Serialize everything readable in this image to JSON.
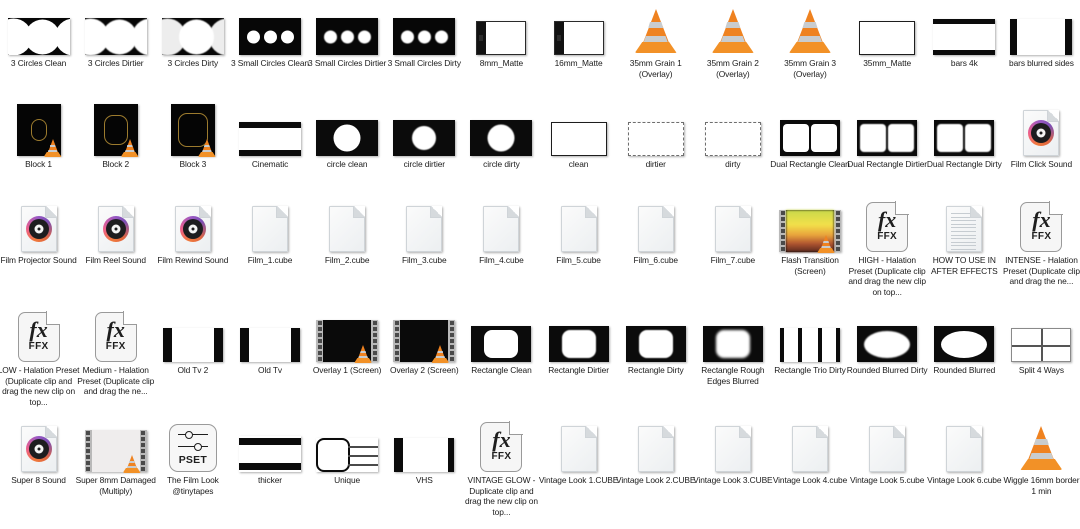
{
  "window": {
    "view": "Large icons grid",
    "background": "#ffffff",
    "columns": 14,
    "rows": 5
  },
  "palette": {
    "label_text": "#1b1b1b",
    "matte_black": "#070707",
    "matte_white": "#ffffff",
    "vlc_orange": "#ef8220",
    "vlc_grey": "#c9ccce",
    "doc_grey": "#eceff1",
    "ffx_border": "#9a9a9a"
  },
  "items": [
    {
      "label": "3 Circles Clean",
      "icon": "matte-3-circles-clean",
      "kind": "image-matte"
    },
    {
      "label": "3 Circles Dirtier",
      "icon": "matte-3-circles-dirtier",
      "kind": "image-matte"
    },
    {
      "label": "3 Circles Dirty",
      "icon": "matte-3-circles-dirty",
      "kind": "image-matte"
    },
    {
      "label": "3 Small Circles Clean",
      "icon": "matte-3-small-circles-clean",
      "kind": "image-matte"
    },
    {
      "label": "3 Small Circles Dirtier",
      "icon": "matte-3-small-circles-dirtier",
      "kind": "image-matte"
    },
    {
      "label": "3 Small Circles Dirty",
      "icon": "matte-3-small-circles-dirty",
      "kind": "image-matte"
    },
    {
      "label": "8mm_Matte",
      "icon": "matte-8mm",
      "kind": "image-matte"
    },
    {
      "label": "16mm_Matte",
      "icon": "matte-16mm",
      "kind": "image-matte"
    },
    {
      "label": "35mm Grain 1 (Overlay)",
      "icon": "vlc-cone-icon",
      "kind": "video"
    },
    {
      "label": "35mm Grain 2 (Overlay)",
      "icon": "vlc-cone-icon",
      "kind": "video"
    },
    {
      "label": "35mm Grain 3 (Overlay)",
      "icon": "vlc-cone-icon",
      "kind": "video"
    },
    {
      "label": "35mm_Matte",
      "icon": "matte-35mm",
      "kind": "image-matte"
    },
    {
      "label": "bars 4k",
      "icon": "matte-bars-4k",
      "kind": "image-matte"
    },
    {
      "label": "bars blurred sides",
      "icon": "matte-bars-blurred-sides",
      "kind": "image-matte"
    },
    {
      "label": "Block 1",
      "icon": "video-thumb-block-1",
      "kind": "video"
    },
    {
      "label": "Block 2",
      "icon": "video-thumb-block-2",
      "kind": "video"
    },
    {
      "label": "Block 3",
      "icon": "video-thumb-block-3",
      "kind": "video"
    },
    {
      "label": "Cinematic",
      "icon": "matte-cinematic",
      "kind": "image-matte"
    },
    {
      "label": "circle clean",
      "icon": "matte-circle-clean",
      "kind": "image-matte"
    },
    {
      "label": "circle dirtier",
      "icon": "matte-circle-dirtier",
      "kind": "image-matte"
    },
    {
      "label": "circle dirty",
      "icon": "matte-circle-dirty",
      "kind": "image-matte"
    },
    {
      "label": "clean",
      "icon": "matte-clean",
      "kind": "image-matte"
    },
    {
      "label": "dirtier",
      "icon": "matte-dirtier",
      "kind": "image-matte"
    },
    {
      "label": "dirty",
      "icon": "matte-dirty",
      "kind": "image-matte"
    },
    {
      "label": "Dual Rectangle Clean",
      "icon": "matte-dual-rectangle-clean",
      "kind": "image-matte"
    },
    {
      "label": "Dual Rectangle Dirtier",
      "icon": "matte-dual-rectangle-dirtier",
      "kind": "image-matte"
    },
    {
      "label": "Dual Rectangle Dirty",
      "icon": "matte-dual-rectangle-dirty",
      "kind": "image-matte"
    },
    {
      "label": "Film Click Sound",
      "icon": "audio-file-icon",
      "kind": "audio"
    },
    {
      "label": "Film Projector Sound",
      "icon": "audio-file-icon",
      "kind": "audio"
    },
    {
      "label": "Film Reel Sound",
      "icon": "audio-file-icon",
      "kind": "audio"
    },
    {
      "label": "Film Rewind Sound",
      "icon": "audio-file-icon",
      "kind": "audio"
    },
    {
      "label": "Film_1.cube",
      "icon": "generic-file-icon",
      "kind": "lut"
    },
    {
      "label": "Film_2.cube",
      "icon": "generic-file-icon",
      "kind": "lut"
    },
    {
      "label": "Film_3.cube",
      "icon": "generic-file-icon",
      "kind": "lut"
    },
    {
      "label": "Film_4.cube",
      "icon": "generic-file-icon",
      "kind": "lut"
    },
    {
      "label": "Film_5.cube",
      "icon": "generic-file-icon",
      "kind": "lut"
    },
    {
      "label": "Film_6.cube",
      "icon": "generic-file-icon",
      "kind": "lut"
    },
    {
      "label": "Film_7.cube",
      "icon": "generic-file-icon",
      "kind": "lut"
    },
    {
      "label": "Flash Transition (Screen)",
      "icon": "video-filmstrip-flash",
      "kind": "video"
    },
    {
      "label": "HIGH - Halation Preset (Duplicate clip and drag the new clip on top...",
      "icon": "ffx-preset-icon",
      "kind": "preset"
    },
    {
      "label": "HOW TO USE IN AFTER EFFECTS",
      "icon": "text-document-icon",
      "kind": "document"
    },
    {
      "label": "INTENSE - Halation Preset (Duplicate clip and drag the ne...",
      "icon": "ffx-preset-icon",
      "kind": "preset"
    },
    {
      "label": "LOW - Halation Preset (Duplicate clip and drag the new clip on top...",
      "icon": "ffx-preset-icon",
      "kind": "preset"
    },
    {
      "label": "Medium - Halation Preset (Duplicate clip and drag the ne...",
      "icon": "ffx-preset-icon",
      "kind": "preset"
    },
    {
      "label": "Old Tv 2",
      "icon": "matte-old-tv-2",
      "kind": "image-matte"
    },
    {
      "label": "Old Tv",
      "icon": "matte-old-tv",
      "kind": "image-matte"
    },
    {
      "label": "Overlay 1 (Screen)",
      "icon": "video-filmstrip-dark",
      "kind": "video"
    },
    {
      "label": "Overlay 2 (Screen)",
      "icon": "video-filmstrip-dark",
      "kind": "video"
    },
    {
      "label": "Rectangle Clean",
      "icon": "matte-rectangle-clean",
      "kind": "image-matte"
    },
    {
      "label": "Rectangle Dirtier",
      "icon": "matte-rectangle-dirtier",
      "kind": "image-matte"
    },
    {
      "label": "Rectangle Dirty",
      "icon": "matte-rectangle-dirty",
      "kind": "image-matte"
    },
    {
      "label": "Rectangle Rough Edges Blurred",
      "icon": "matte-rectangle-rough-edges",
      "kind": "image-matte"
    },
    {
      "label": "Rectangle Trio Dirty",
      "icon": "matte-rectangle-trio-dirty",
      "kind": "image-matte"
    },
    {
      "label": "Rounded Blurred Dirty",
      "icon": "matte-rounded-blurred-dirty",
      "kind": "image-matte"
    },
    {
      "label": "Rounded Blurred",
      "icon": "matte-rounded-blurred",
      "kind": "image-matte"
    },
    {
      "label": "Split 4 Ways",
      "icon": "matte-split-4-ways",
      "kind": "image-matte"
    },
    {
      "label": "Super 8 Sound",
      "icon": "audio-file-icon",
      "kind": "audio"
    },
    {
      "label": "Super 8mm Damaged (Multiply)",
      "icon": "video-filmstrip-light",
      "kind": "video"
    },
    {
      "label": "The Film Look @tinytapes",
      "icon": "pset-preset-icon",
      "kind": "preset"
    },
    {
      "label": "thicker",
      "icon": "matte-thicker",
      "kind": "image-matte"
    },
    {
      "label": "Unique",
      "icon": "matte-unique",
      "kind": "image-matte"
    },
    {
      "label": "VHS",
      "icon": "matte-vhs",
      "kind": "image-matte"
    },
    {
      "label": "VINTAGE GLOW - Duplicate clip and drag the new clip on top...",
      "icon": "ffx-preset-icon",
      "kind": "preset"
    },
    {
      "label": "Vintage Look 1.CUBE",
      "icon": "generic-file-icon",
      "kind": "lut"
    },
    {
      "label": "Vintage Look 2.CUBE",
      "icon": "generic-file-icon",
      "kind": "lut"
    },
    {
      "label": "Vintage Look 3.CUBE",
      "icon": "generic-file-icon",
      "kind": "lut"
    },
    {
      "label": "Vintage Look 4.cube",
      "icon": "generic-file-icon",
      "kind": "lut"
    },
    {
      "label": "Vintage Look 5.cube",
      "icon": "generic-file-icon",
      "kind": "lut"
    },
    {
      "label": "Vintage Look 6.cube",
      "icon": "generic-file-icon",
      "kind": "lut"
    },
    {
      "label": "Wiggle 16mm border 1 min",
      "icon": "vlc-cone-icon",
      "kind": "video"
    }
  ]
}
